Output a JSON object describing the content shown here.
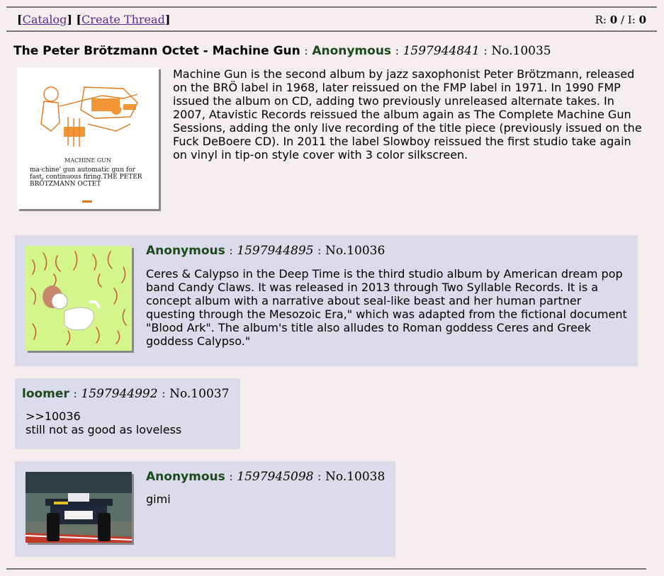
{
  "nav": {
    "open_bracket": "[",
    "catalog": "Catalog",
    "between": "] [",
    "create_thread": "Create Thread",
    "close_bracket": "]"
  },
  "stats": {
    "r_label": "R:",
    "r_value": "0",
    "slash": "/",
    "i_label": "I:",
    "i_value": "0"
  },
  "op": {
    "subject": "The Peter Brötzmann Octet - Machine Gun",
    "name": "Anonymous",
    "time": "1597944841",
    "no": "No.10035",
    "image_caption": "MACHINE GUN",
    "image_definition": "ma·chine' gun automatic gun for fast, continuous firing.THE PETER BRÖTZMANN OCTET",
    "text": "Machine Gun is the second album by jazz saxophonist Peter Brötzmann, released on the BRÖ label in 1968, later reissued on the FMP label in 1971. In 1990 FMP issued the album on CD, adding two previously unreleased alternate takes. In 2007, Atavistic Records reissued the album again as The Complete Machine Gun Sessions, adding the only live recording of the title piece (previously issued on the Fuck DeBoere CD). In 2011 the label Slowboy reissued the first studio take again on vinyl in tip-on style cover with 3 color silkscreen."
  },
  "replies": [
    {
      "name": "Anonymous",
      "time": "1597944895",
      "no": "No.10036",
      "text": "Ceres & Calypso in the Deep Time is the third studio album by American dream pop band Candy Claws. It was released in 2013 through Two Syllable Records. It is a concept album with a narrative about seal-like beast and her human partner questing through the Mesozoic Era,\" which was adapted from the fictional document \"Blood Ark\". The album's title also alludes to Roman goddess Ceres and Greek goddess Calypso.\""
    },
    {
      "name": "loomer",
      "time": "1597944992",
      "no": "No.10037",
      "quote": ">>10036",
      "text": "still not as good as loveless"
    },
    {
      "name": "Anonymous",
      "time": "1597945098",
      "no": "No.10038",
      "text": "gimi"
    }
  ],
  "colon": ":",
  "colors": {
    "name": "#1b4a1b",
    "reply_bg": "#dcdbeb",
    "page_bg": "#f5edee",
    "link": "#5a2a8c"
  }
}
